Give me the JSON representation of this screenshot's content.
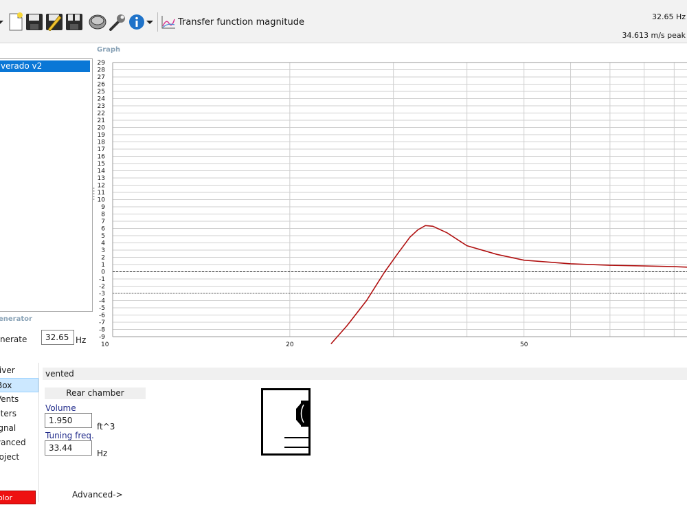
{
  "toolbar": {
    "buttons": [
      {
        "icon": "chevron-down-icon"
      },
      {
        "icon": "new-file-icon"
      },
      {
        "icon": "save-icon"
      },
      {
        "icon": "save-as-icon"
      },
      {
        "icon": "save-all-icon"
      },
      {
        "icon": "driver-icon"
      },
      {
        "icon": "wrench-icon"
      },
      {
        "icon": "info-icon"
      },
      {
        "icon": "chevron-down-icon"
      },
      {
        "icon": "graph-icon"
      }
    ],
    "graph_title": "Transfer function magnitude",
    "freq_readout": "32.65 Hz",
    "peak_readout": "34.613 m/s peak"
  },
  "graph": {
    "section_label": "Graph"
  },
  "driver_list": {
    "items": [
      "verado v2"
    ]
  },
  "generator": {
    "section_label": "enerator",
    "label": "nerate",
    "value": "32.65",
    "unit": "Hz"
  },
  "nav": {
    "items": [
      {
        "label": "river",
        "selected": false
      },
      {
        "label": "Box",
        "selected": true
      },
      {
        "label": "Vents",
        "selected": false
      },
      {
        "label": "ilters",
        "selected": false
      },
      {
        "label": "ignal",
        "selected": false
      },
      {
        "label": "vanced",
        "selected": false
      },
      {
        "label": "roject",
        "selected": false
      }
    ],
    "color_button": "olor"
  },
  "box": {
    "type_header": "vented",
    "chamber_button": "Rear chamber",
    "volume_label": "Volume",
    "volume_value": "1.950",
    "volume_unit": "ft^3",
    "tuning_label": "Tuning freq.",
    "tuning_value": "33.44",
    "tuning_unit": "Hz",
    "advanced_link": "Advanced->"
  },
  "colors": {
    "curve": "#b01010",
    "selection": "#0a77d6",
    "grid": "#cfcfcf",
    "color_button": "#ee1111"
  },
  "chart_data": {
    "type": "line",
    "x_scale": "log",
    "xlim": [
      10,
      100
    ],
    "ylim": [
      -9,
      29
    ],
    "x_ticks": [
      "10",
      "20",
      "50",
      "10"
    ],
    "y_ticks": [
      "29",
      "28",
      "27",
      "26",
      "25",
      "24",
      "23",
      "22",
      "21",
      "20",
      "19",
      "18",
      "17",
      "16",
      "15",
      "14",
      "13",
      "12",
      "11",
      "10",
      "9",
      "8",
      "7",
      "6",
      "5",
      "4",
      "3",
      "2",
      "1",
      "0",
      "-1",
      "-2",
      "-3",
      "-4",
      "-5",
      "-6",
      "-7",
      "-8",
      "-9"
    ],
    "reference_lines": [
      0,
      -3
    ],
    "grid": true,
    "series": [
      {
        "x": [
          23.5,
          25,
          27,
          29,
          30.5,
          32,
          33,
          34,
          35,
          37,
          40,
          45,
          50,
          60,
          70,
          80,
          90,
          100
        ],
        "y": [
          -10,
          -7.5,
          -4,
          0,
          2.5,
          4.8,
          5.8,
          6.4,
          6.3,
          5.4,
          3.6,
          2.4,
          1.6,
          1.1,
          0.9,
          0.8,
          0.7,
          0.55
        ]
      }
    ]
  }
}
